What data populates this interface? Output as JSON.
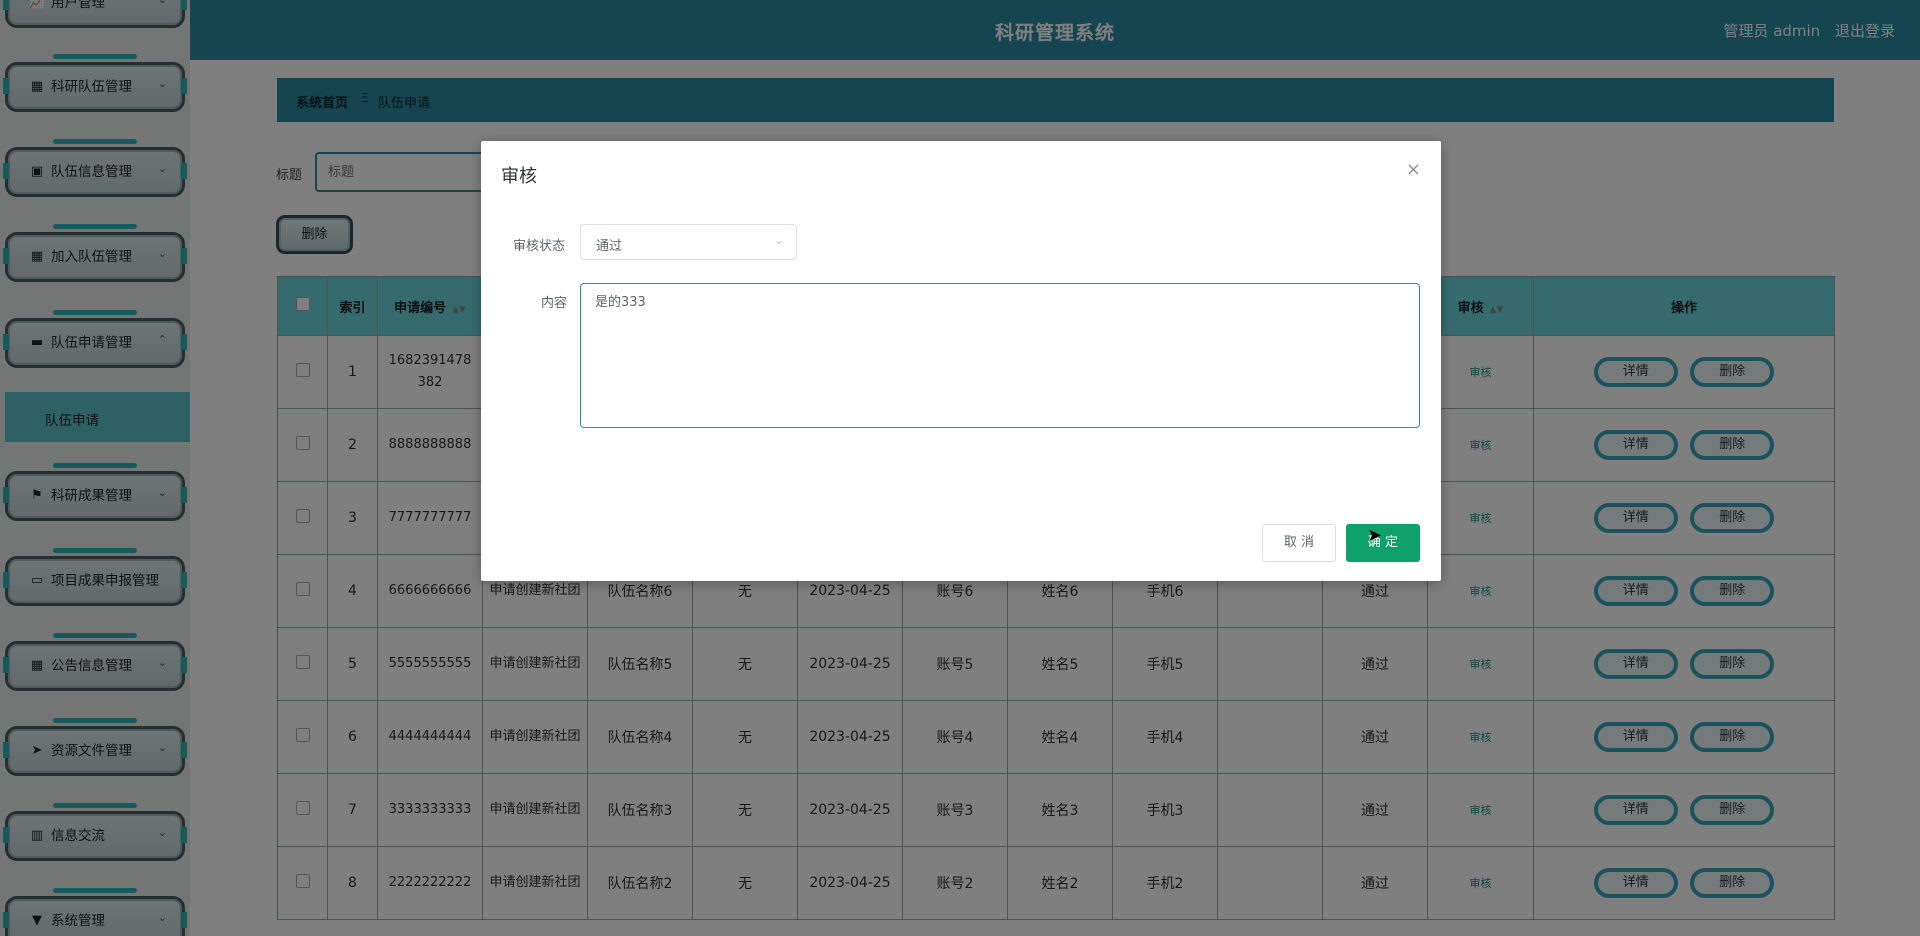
{
  "header": {
    "title": "科研管理系统",
    "user": "管理员 admin",
    "logout": "退出登录"
  },
  "sidebar": {
    "items": [
      {
        "label": "用户管理",
        "icon": "chart-icon"
      },
      {
        "label": "科研队伍管理",
        "icon": "grid-icon"
      },
      {
        "label": "队伍信息管理",
        "icon": "clipboard-icon"
      },
      {
        "label": "加入队伍管理",
        "icon": "grid-icon"
      },
      {
        "label": "队伍申请管理",
        "icon": "box-icon"
      },
      {
        "label": "科研成果管理",
        "icon": "flag-icon"
      },
      {
        "label": "项目成果申报管理",
        "icon": "monitor-icon"
      },
      {
        "label": "公告信息管理",
        "icon": "grid-icon"
      },
      {
        "label": "资源文件管理",
        "icon": "send-icon"
      },
      {
        "label": "信息交流",
        "icon": "book-icon"
      },
      {
        "label": "系统管理",
        "icon": "pin-icon"
      }
    ],
    "submenu_active": "队伍申请"
  },
  "breadcrumb": {
    "home": "系统首页",
    "current": "队伍申请"
  },
  "search": {
    "label": "标题",
    "placeholder": "标题"
  },
  "toolbar": {
    "delete_label": "删除"
  },
  "table": {
    "headers": {
      "index": "索引",
      "apply_no": "申请编号",
      "audit": "审核",
      "actions": "操作"
    },
    "rows": [
      {
        "index": "1",
        "apply_no": "1682391478382",
        "audit": "审核",
        "detail": "详情",
        "delete": "删除"
      },
      {
        "index": "2",
        "apply_no": "8888888888",
        "audit": "审核",
        "detail": "详情",
        "delete": "删除"
      },
      {
        "index": "3",
        "apply_no": "7777777777",
        "audit": "审核",
        "detail": "详情",
        "delete": "删除"
      },
      {
        "index": "4",
        "apply_no": "6666666666",
        "title": "申请创建新社团",
        "team": "队伍名称6",
        "remark": "无",
        "date": "2023-04-25",
        "account": "账号6",
        "name": "姓名6",
        "phone": "手机6",
        "reply": "",
        "status": "通过",
        "audit": "审核",
        "detail": "详情",
        "delete": "删除"
      },
      {
        "index": "5",
        "apply_no": "5555555555",
        "title": "申请创建新社团",
        "team": "队伍名称5",
        "remark": "无",
        "date": "2023-04-25",
        "account": "账号5",
        "name": "姓名5",
        "phone": "手机5",
        "reply": "",
        "status": "通过",
        "audit": "审核",
        "detail": "详情",
        "delete": "删除"
      },
      {
        "index": "6",
        "apply_no": "4444444444",
        "title": "申请创建新社团",
        "team": "队伍名称4",
        "remark": "无",
        "date": "2023-04-25",
        "account": "账号4",
        "name": "姓名4",
        "phone": "手机4",
        "reply": "",
        "status": "通过",
        "audit": "审核",
        "detail": "详情",
        "delete": "删除"
      },
      {
        "index": "7",
        "apply_no": "3333333333",
        "title": "申请创建新社团",
        "team": "队伍名称3",
        "remark": "无",
        "date": "2023-04-25",
        "account": "账号3",
        "name": "姓名3",
        "phone": "手机3",
        "reply": "",
        "status": "通过",
        "audit": "审核",
        "detail": "详情",
        "delete": "删除"
      },
      {
        "index": "8",
        "apply_no": "2222222222",
        "title": "申请创建新社团",
        "team": "队伍名称2",
        "remark": "无",
        "date": "2023-04-25",
        "account": "账号2",
        "name": "姓名2",
        "phone": "手机2",
        "reply": "",
        "status": "通过",
        "audit": "审核",
        "detail": "详情",
        "delete": "删除"
      }
    ]
  },
  "dialog": {
    "title": "审核",
    "close": "×",
    "status_label": "审核状态",
    "status_value": "通过",
    "content_label": "内容",
    "content_value": "是的333",
    "cancel_label": "取 消",
    "confirm_label": "确 定"
  },
  "colors": {
    "primary": "#2d8ba4",
    "header_row": "#6dd6dd",
    "confirm": "#0fa16c"
  }
}
